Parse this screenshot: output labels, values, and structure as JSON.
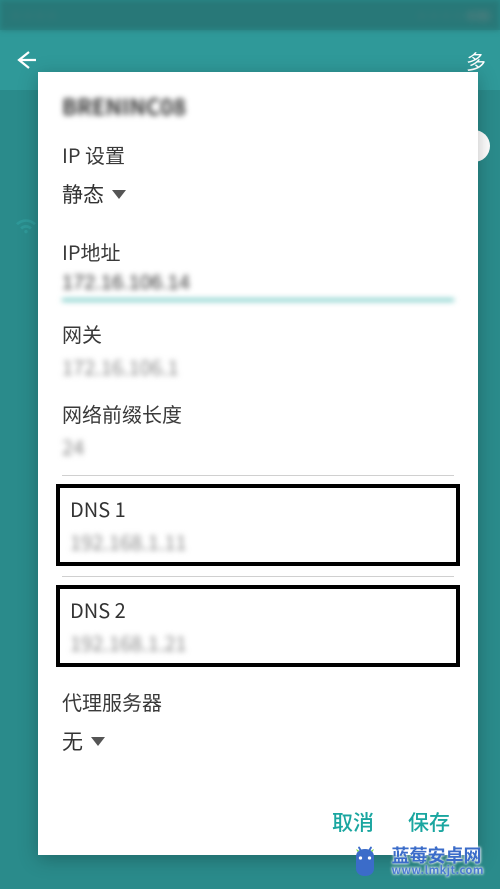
{
  "status_bar": {
    "left_blur": "····",
    "right_blur": "···· 4:56"
  },
  "app_bar": {
    "more_label": "多"
  },
  "dialog": {
    "title": "BRENINC08",
    "ip_setting_label": "IP 设置",
    "ip_mode": "静态",
    "ip_address_label": "IP地址",
    "ip_address_value": "172.16.106.14",
    "gateway_label": "网关",
    "gateway_value": "172.16.106.1",
    "prefix_label": "网络前缀长度",
    "prefix_value": "24",
    "dns1_label": "DNS 1",
    "dns1_value": "192.168.1.11",
    "dns2_label": "DNS 2",
    "dns2_value": "192.168.1.21",
    "proxy_label": "代理服务器",
    "proxy_value": "无",
    "cancel_label": "取消",
    "save_label": "保存"
  },
  "watermark": {
    "text_line1": "蓝莓安卓网",
    "text_line2": "www.lmkjt.com"
  }
}
